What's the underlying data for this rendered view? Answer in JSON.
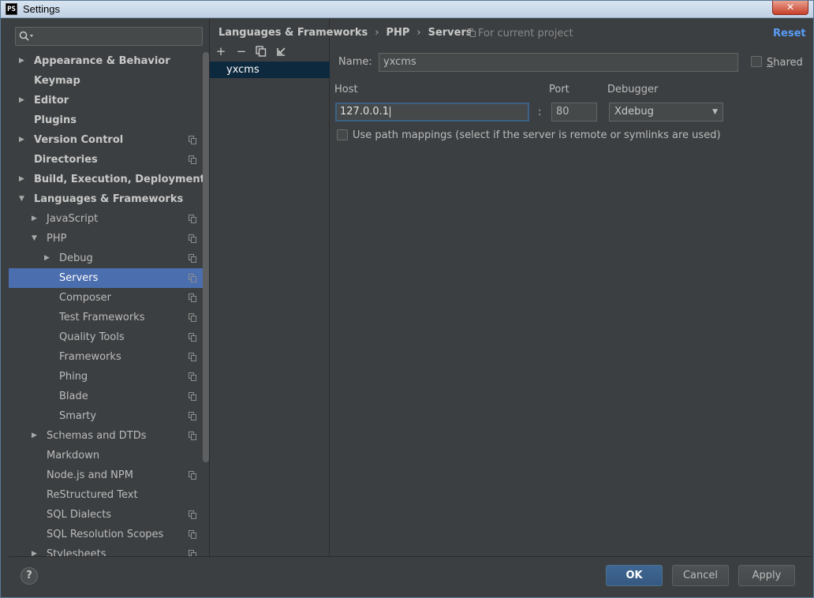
{
  "window": {
    "title": "Settings",
    "app_icon": "PS",
    "close_glyph": "✕"
  },
  "search": {
    "placeholder": ""
  },
  "sidebar": {
    "items": [
      {
        "label": "Appearance & Behavior",
        "level": 0,
        "arrow": "▶",
        "bold": true,
        "badge": false
      },
      {
        "label": "Keymap",
        "level": 0,
        "arrow": "",
        "bold": true,
        "badge": false
      },
      {
        "label": "Editor",
        "level": 0,
        "arrow": "▶",
        "bold": true,
        "badge": false
      },
      {
        "label": "Plugins",
        "level": 0,
        "arrow": "",
        "bold": true,
        "badge": false
      },
      {
        "label": "Version Control",
        "level": 0,
        "arrow": "▶",
        "bold": true,
        "badge": true
      },
      {
        "label": "Directories",
        "level": 0,
        "arrow": "",
        "bold": true,
        "badge": true
      },
      {
        "label": "Build, Execution, Deployment",
        "level": 0,
        "arrow": "▶",
        "bold": true,
        "badge": false
      },
      {
        "label": "Languages & Frameworks",
        "level": 0,
        "arrow": "▼",
        "bold": true,
        "badge": false
      },
      {
        "label": "JavaScript",
        "level": 1,
        "arrow": "▶",
        "bold": false,
        "badge": true
      },
      {
        "label": "PHP",
        "level": 1,
        "arrow": "▼",
        "bold": false,
        "badge": true
      },
      {
        "label": "Debug",
        "level": 2,
        "arrow": "▶",
        "bold": false,
        "badge": true
      },
      {
        "label": "Servers",
        "level": 2,
        "arrow": "",
        "bold": false,
        "badge": true,
        "selected": true
      },
      {
        "label": "Composer",
        "level": 2,
        "arrow": "",
        "bold": false,
        "badge": true
      },
      {
        "label": "Test Frameworks",
        "level": 2,
        "arrow": "",
        "bold": false,
        "badge": true
      },
      {
        "label": "Quality Tools",
        "level": 2,
        "arrow": "",
        "bold": false,
        "badge": true
      },
      {
        "label": "Frameworks",
        "level": 2,
        "arrow": "",
        "bold": false,
        "badge": true
      },
      {
        "label": "Phing",
        "level": 2,
        "arrow": "",
        "bold": false,
        "badge": true
      },
      {
        "label": "Blade",
        "level": 2,
        "arrow": "",
        "bold": false,
        "badge": true
      },
      {
        "label": "Smarty",
        "level": 2,
        "arrow": "",
        "bold": false,
        "badge": true
      },
      {
        "label": "Schemas and DTDs",
        "level": 1,
        "arrow": "▶",
        "bold": false,
        "badge": true
      },
      {
        "label": "Markdown",
        "level": 1,
        "arrow": "",
        "bold": false,
        "badge": false
      },
      {
        "label": "Node.js and NPM",
        "level": 1,
        "arrow": "",
        "bold": false,
        "badge": true
      },
      {
        "label": "ReStructured Text",
        "level": 1,
        "arrow": "",
        "bold": false,
        "badge": false
      },
      {
        "label": "SQL Dialects",
        "level": 1,
        "arrow": "",
        "bold": false,
        "badge": true
      },
      {
        "label": "SQL Resolution Scopes",
        "level": 1,
        "arrow": "",
        "bold": false,
        "badge": true
      },
      {
        "label": "Stylesheets",
        "level": 1,
        "arrow": "▶",
        "bold": false,
        "badge": true
      }
    ]
  },
  "servers": {
    "toolbar": {
      "add": "+",
      "remove": "−",
      "copy": "⧉",
      "import": "⇲"
    },
    "list": [
      "yxcms"
    ]
  },
  "header": {
    "breadcrumb": [
      "Languages & Frameworks",
      "PHP",
      "Servers"
    ],
    "separator": "›",
    "for_current_project": "For current project",
    "reset": "Reset"
  },
  "form": {
    "name_label": "Name:",
    "name_value": "yxcms",
    "shared_label": "Shared",
    "host_label": "Host",
    "host_value": "127.0.0.1",
    "port_label": "Port",
    "port_colon": ":",
    "port_value": "80",
    "debugger_label": "Debugger",
    "debugger_value": "Xdebug",
    "path_mappings_label": "Use path mappings (select if the server is remote or symlinks are used)"
  },
  "footer": {
    "help": "?",
    "ok": "OK",
    "cancel": "Cancel",
    "apply": "Apply"
  },
  "colors": {
    "background": "#3c3f41",
    "selection": "#4b6eaf",
    "link": "#589df6",
    "primary_button": "#365880"
  }
}
